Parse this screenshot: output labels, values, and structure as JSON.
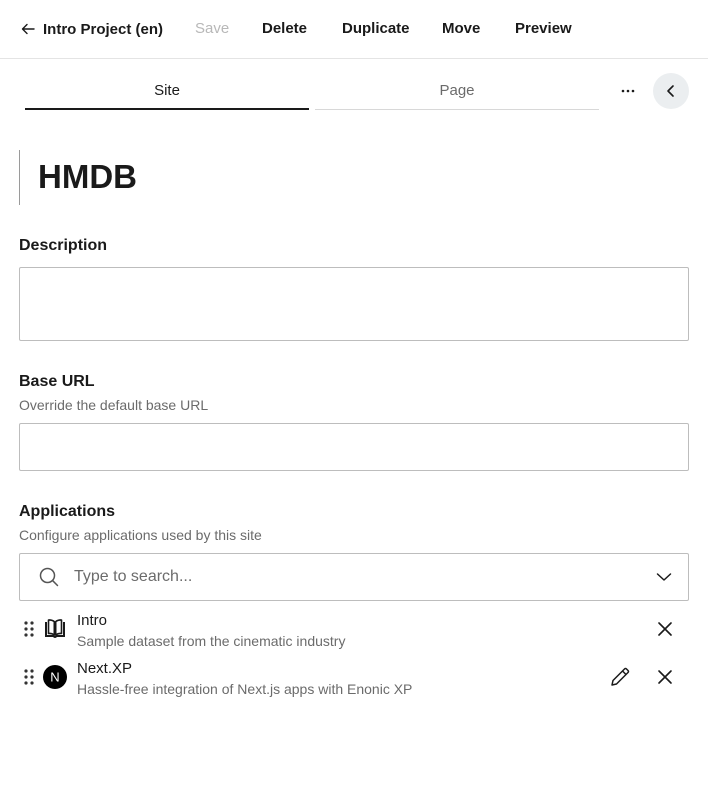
{
  "toolbar": {
    "back_label": "Intro Project (en)",
    "save_label": "Save",
    "delete_label": "Delete",
    "duplicate_label": "Duplicate",
    "move_label": "Move",
    "preview_label": "Preview"
  },
  "tabs": [
    {
      "label": "Site",
      "active": true
    },
    {
      "label": "Page",
      "active": false
    }
  ],
  "more_label": "···",
  "content": {
    "title": "HMDB",
    "description": {
      "label": "Description",
      "value": ""
    },
    "base_url": {
      "label": "Base URL",
      "help": "Override the default base URL",
      "value": ""
    },
    "applications": {
      "label": "Applications",
      "help": "Configure applications used by this site",
      "search_placeholder": "Type to search...",
      "items": [
        {
          "name": "Intro",
          "description": "Sample dataset from the cinematic industry",
          "icon": "open-book-icon",
          "editable": false
        },
        {
          "name": "Next.XP",
          "description": "Hassle-free integration of Next.js apps with Enonic XP",
          "icon": "nextjs-logo-icon",
          "icon_letter": "N",
          "editable": true
        }
      ]
    }
  },
  "colors": {
    "text": "#1a1a1a",
    "muted": "#6b6b6b",
    "disabled": "#b8b8b8",
    "border": "#bdbdbd",
    "circle_button_bg": "#ebeef0"
  }
}
